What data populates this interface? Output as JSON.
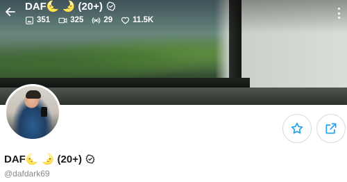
{
  "header": {
    "title": "DAF🌜 🌛 (20+)",
    "stats": {
      "photos": "351",
      "videos": "325",
      "streams": "29",
      "likes": "11.5K"
    }
  },
  "profile": {
    "name": "DAF🌜 🌛 (20+)",
    "handle": "@dafdark69"
  },
  "colors": {
    "accent": "#1da1f2",
    "header_text": "#ffffff",
    "name_text": "#1a1a1a",
    "handle_text": "#8a8a8a",
    "button_border": "#d6dbe1"
  },
  "icons": {
    "back": "arrow-left-icon",
    "photos": "image-icon",
    "videos": "video-icon",
    "streams": "broadcast-icon",
    "likes": "heart-icon",
    "verified": "verified-check-icon",
    "more": "more-vertical-icon",
    "favorite": "star-icon",
    "share": "share-icon"
  }
}
